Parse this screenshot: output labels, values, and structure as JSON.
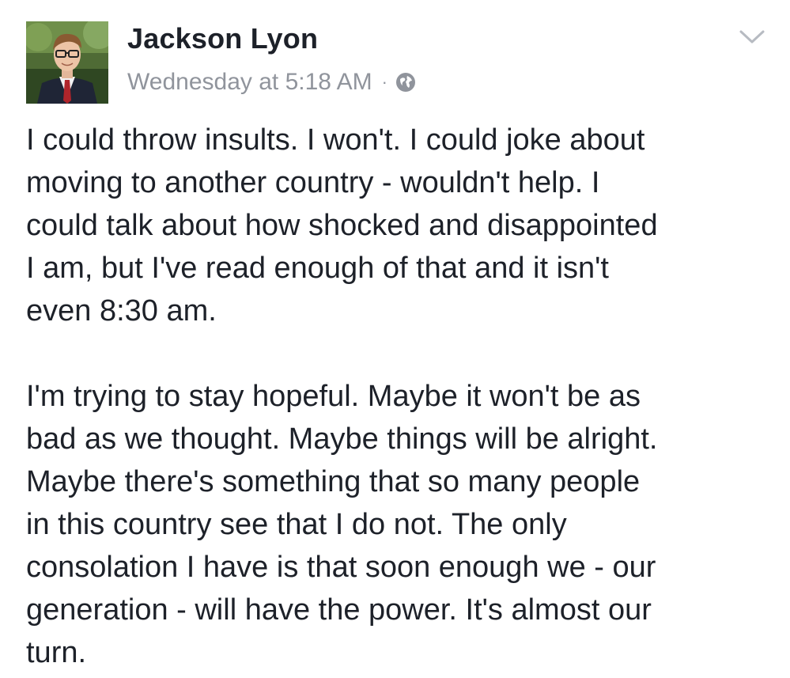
{
  "post": {
    "author_name": "Jackson Lyon",
    "timestamp": "Wednesday at 5:18 AM",
    "separator": "·",
    "audience_icon": "globe-icon",
    "options_icon": "chevron-down-icon",
    "paragraphs": [
      "I could throw insults.  I won't.  I could joke about\nmoving to another country - wouldn't help.  I\ncould talk about how shocked and disappointed\nI am, but I've read enough of that and it isn't\neven 8:30 am.",
      "I'm trying to stay hopeful.  Maybe it won't be as\nbad as we thought.  Maybe things will be alright.\nMaybe there's something that so many people\nin this country see that I do not.  The only\nconsolation I have is that soon enough we - our\ngeneration - will have the power.  It's almost our\nturn."
    ]
  },
  "colors": {
    "text": "#1d2129",
    "meta": "#90949c",
    "background": "#ffffff"
  }
}
